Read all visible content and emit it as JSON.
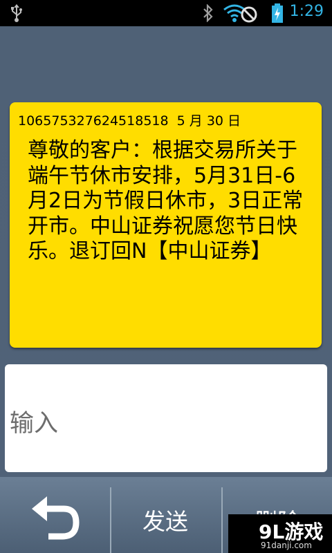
{
  "status_bar": {
    "time": "1:29",
    "icons": [
      "usb-icon",
      "bluetooth-icon",
      "wifi-off-icon",
      "battery-charging-icon"
    ],
    "accent_color": "#33b5e5"
  },
  "message": {
    "header": "106575327624518518  5 月 30 日",
    "body": "尊敬的客户：根据交易所关于端午节休市安排，5月31日-6月2日为节假日休市，3日正常开市。中山证券祝愿您节日快乐。退订回N【中山证券】",
    "bubble_color": "#ffdd00"
  },
  "compose": {
    "placeholder": "输入"
  },
  "toolbar": {
    "back_icon": "back-arrow-icon",
    "send_label": "发送",
    "delete_label": "删除"
  },
  "watermark": {
    "logo": "9L游戏",
    "url": "91danji.com"
  }
}
